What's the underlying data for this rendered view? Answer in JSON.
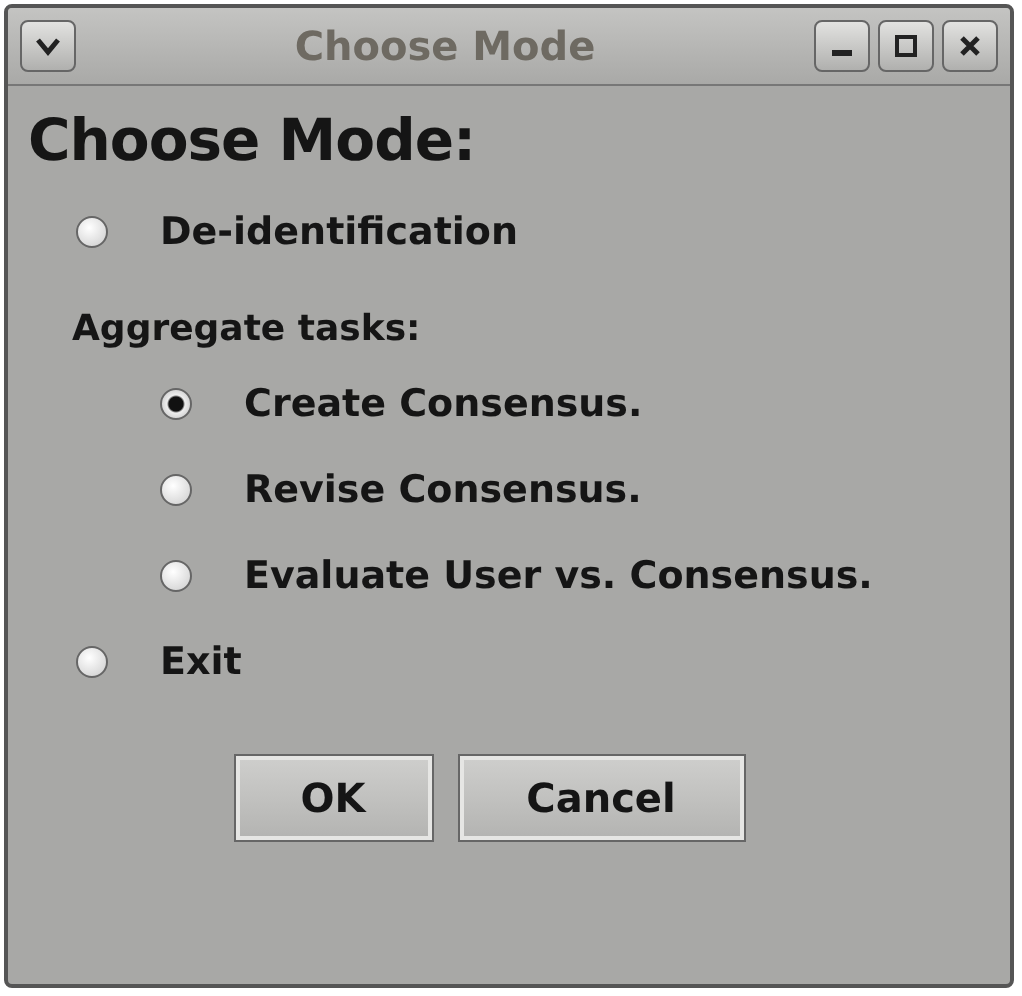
{
  "window": {
    "title": "Choose Mode"
  },
  "heading": "Choose Mode:",
  "choices": [
    {
      "kind": "radio",
      "label": "De-identification",
      "selected": false
    },
    {
      "kind": "group",
      "label": "Aggregate tasks:",
      "children": [
        {
          "label": "Create Consensus.",
          "selected": true
        },
        {
          "label": "Revise Consensus.",
          "selected": false
        },
        {
          "label": "Evaluate User vs. Consensus.",
          "selected": false
        }
      ]
    },
    {
      "kind": "radio",
      "label": "Exit",
      "selected": false
    }
  ],
  "buttons": [
    "OK",
    "Cancel"
  ]
}
